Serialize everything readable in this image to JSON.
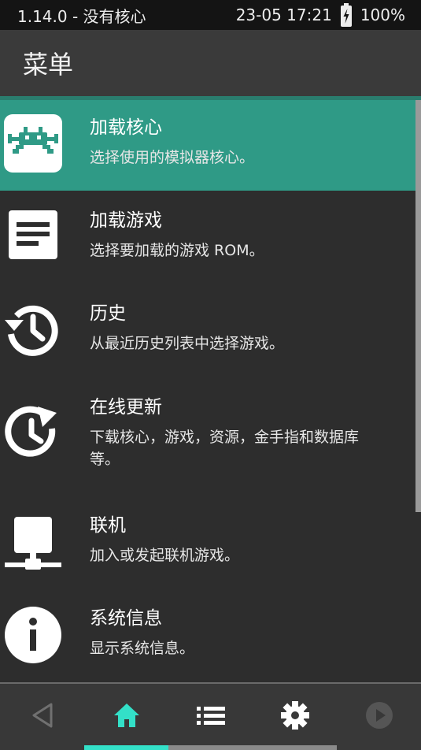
{
  "status_bar": {
    "left": "1.14.0 - 没有核心",
    "datetime": "23-05 17:21",
    "battery": "100%",
    "battery_icon": "battery-charging-icon"
  },
  "header": {
    "title": "菜单"
  },
  "menu": {
    "items": [
      {
        "title": "加载核心",
        "subtitle": "选择使用的模拟器核心。",
        "icon": "retroarch-invader-icon",
        "selected": true
      },
      {
        "title": "加载游戏",
        "subtitle": "选择要加载的游戏 ROM。",
        "icon": "document-icon",
        "selected": false
      },
      {
        "title": "历史",
        "subtitle": "从最近历史列表中选择游戏。",
        "icon": "history-icon",
        "selected": false
      },
      {
        "title": "在线更新",
        "subtitle": "下载核心，游戏，资源，金手指和数据库等。",
        "icon": "update-clock-icon",
        "selected": false
      },
      {
        "title": "联机",
        "subtitle": "加入或发起联机游戏。",
        "icon": "network-icon",
        "selected": false
      },
      {
        "title": "系统信息",
        "subtitle": "显示系统信息。",
        "icon": "info-icon",
        "selected": false
      }
    ]
  },
  "bottom_nav": {
    "buttons": [
      "back-icon",
      "home-icon",
      "list-icon",
      "settings-gear-icon",
      "resume-play-icon"
    ],
    "active": "home-icon"
  },
  "colors": {
    "accent": "#2f9a86",
    "accent_bright": "#33e0c8",
    "background": "#2d2d2d",
    "header": "#3a3a3a",
    "status_bar": "#141414"
  }
}
